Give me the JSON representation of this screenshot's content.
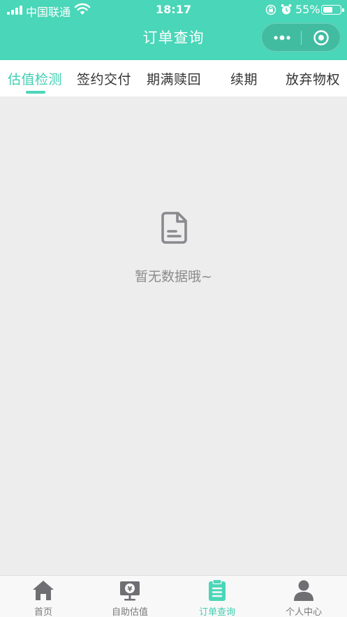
{
  "status_bar": {
    "carrier": "中国联通",
    "time": "18:17",
    "battery": "55%",
    "battery_level": 0.55
  },
  "nav": {
    "title": "订单查询"
  },
  "tabs": [
    {
      "label": "估值检测",
      "active": true
    },
    {
      "label": "签约交付",
      "active": false
    },
    {
      "label": "期满赎回",
      "active": false
    },
    {
      "label": "续期",
      "active": false
    },
    {
      "label": "放弃物权",
      "active": false
    }
  ],
  "empty_state": {
    "icon": "document-icon",
    "text": "暂无数据哦~"
  },
  "tabbar": [
    {
      "label": "首页",
      "icon": "home-icon",
      "active": false
    },
    {
      "label": "自助估值",
      "icon": "valuation-monitor-icon",
      "active": false
    },
    {
      "label": "订单查询",
      "icon": "clipboard-icon",
      "active": true
    },
    {
      "label": "个人中心",
      "icon": "user-icon",
      "active": false
    }
  ],
  "colors": {
    "brand": "#4ad6b8",
    "active_text": "#3fcfb2",
    "inactive_icon": "#6e6e73",
    "background": "#ededed"
  }
}
